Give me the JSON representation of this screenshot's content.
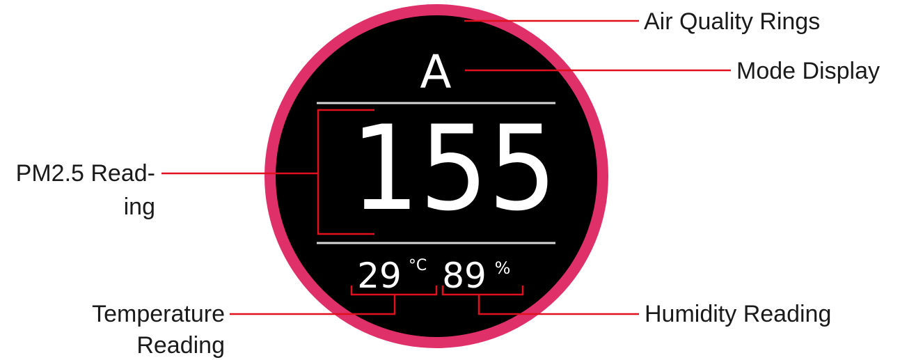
{
  "device": {
    "mode": "A",
    "pm25": "155",
    "temperature": "29",
    "temperature_unit": "°C",
    "humidity": "89",
    "humidity_unit": "%",
    "ring_color": "#e0306a",
    "screen_color": "#000000",
    "leader_color": "#e0101e"
  },
  "callouts": {
    "air_quality_rings": "Air Quality Rings",
    "mode_display": "Mode Display",
    "pm25_line1": "PM2.5 Read-",
    "pm25_line2": "ing",
    "temperature_line1": "Temperature",
    "temperature_line2": "Reading",
    "humidity_reading": "Humidity Reading"
  }
}
